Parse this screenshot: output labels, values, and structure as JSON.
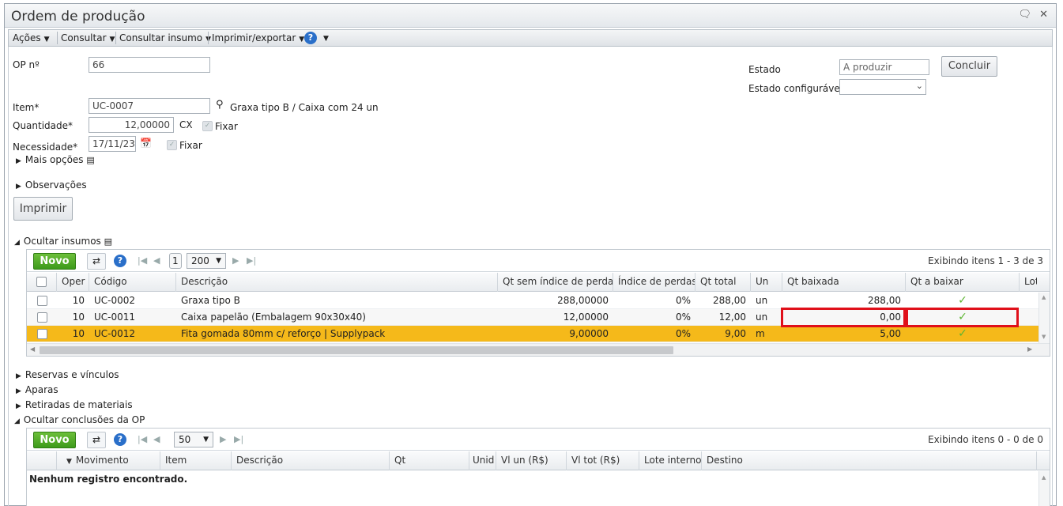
{
  "window": {
    "title": "Ordem de produção"
  },
  "menu": [
    {
      "label": "Ações"
    },
    {
      "label": "Consultar"
    },
    {
      "label": "Consultar insumo"
    },
    {
      "label": "Imprimir/exportar"
    }
  ],
  "form": {
    "op_label": "OP nº",
    "op_value": "66",
    "item_label": "Item*",
    "item_value": "UC-0007",
    "item_desc": "Graxa tipo B / Caixa com 24 un",
    "qty_label": "Quantidade*",
    "qty_value": "12,00000",
    "qty_unit": "CX",
    "fixar1": "Fixar",
    "need_label": "Necessidade*",
    "need_value": "17/11/23",
    "fixar2": "Fixar",
    "mais_opcoes": "Mais opções",
    "observacoes": "Observações",
    "imprimir": "Imprimir",
    "estado_label": "Estado",
    "estado_value": "A produzir",
    "estado_conf_label": "Estado configurável",
    "estado_conf_value": "",
    "concluir": "Concluir"
  },
  "insumos": {
    "toggle": "Ocultar insumos",
    "novo": "Novo",
    "page": "1",
    "page_size": "200",
    "display": "Exibindo itens 1 - 3 de 3",
    "columns": [
      "Oper",
      "Código",
      "Descrição",
      "Qt sem índice de perdas",
      "Índice de perdas",
      "Qt total",
      "Un",
      "Qt baixada",
      "Qt a baixar",
      "Lot"
    ],
    "rows": [
      {
        "oper": "10",
        "codigo": "UC-0002",
        "descricao": "Graxa tipo B",
        "qt_sem": "288,00000",
        "indice": "0%",
        "qt_total": "288,00",
        "un": "un",
        "qt_baixada": "288,00",
        "qt_a_baixar": "✓"
      },
      {
        "oper": "10",
        "codigo": "UC-0011",
        "descricao": "Caixa papelão (Embalagem 90x30x40)",
        "qt_sem": "12,00000",
        "indice": "0%",
        "qt_total": "12,00",
        "un": "un",
        "qt_baixada": "0,00",
        "qt_a_baixar": "✓"
      },
      {
        "oper": "10",
        "codigo": "UC-0012",
        "descricao": "Fita gomada 80mm c/ reforço | Supplypack",
        "qt_sem": "9,00000",
        "indice": "0%",
        "qt_total": "9,00",
        "un": "m",
        "qt_baixada": "5,00",
        "qt_a_baixar": "✓"
      }
    ]
  },
  "sections": {
    "reservas": "Reservas e vínculos",
    "aparas": "Aparas",
    "retiradas": "Retiradas de materiais",
    "conclusoes": "Ocultar conclusões da OP"
  },
  "conclusoes": {
    "novo": "Novo",
    "page_size": "50",
    "display": "Exibindo itens 0 - 0 de 0",
    "columns": [
      "Movimento",
      "Item",
      "Descrição",
      "Qt",
      "Unid",
      "Vl un (R$)",
      "Vl tot (R$)",
      "Lote interno",
      "Destino"
    ],
    "empty": "Nenhum registro encontrado."
  },
  "colors": {
    "accent_green": "#4aa523",
    "selected_row": "#f5b91a",
    "highlight": "#e0101a"
  }
}
